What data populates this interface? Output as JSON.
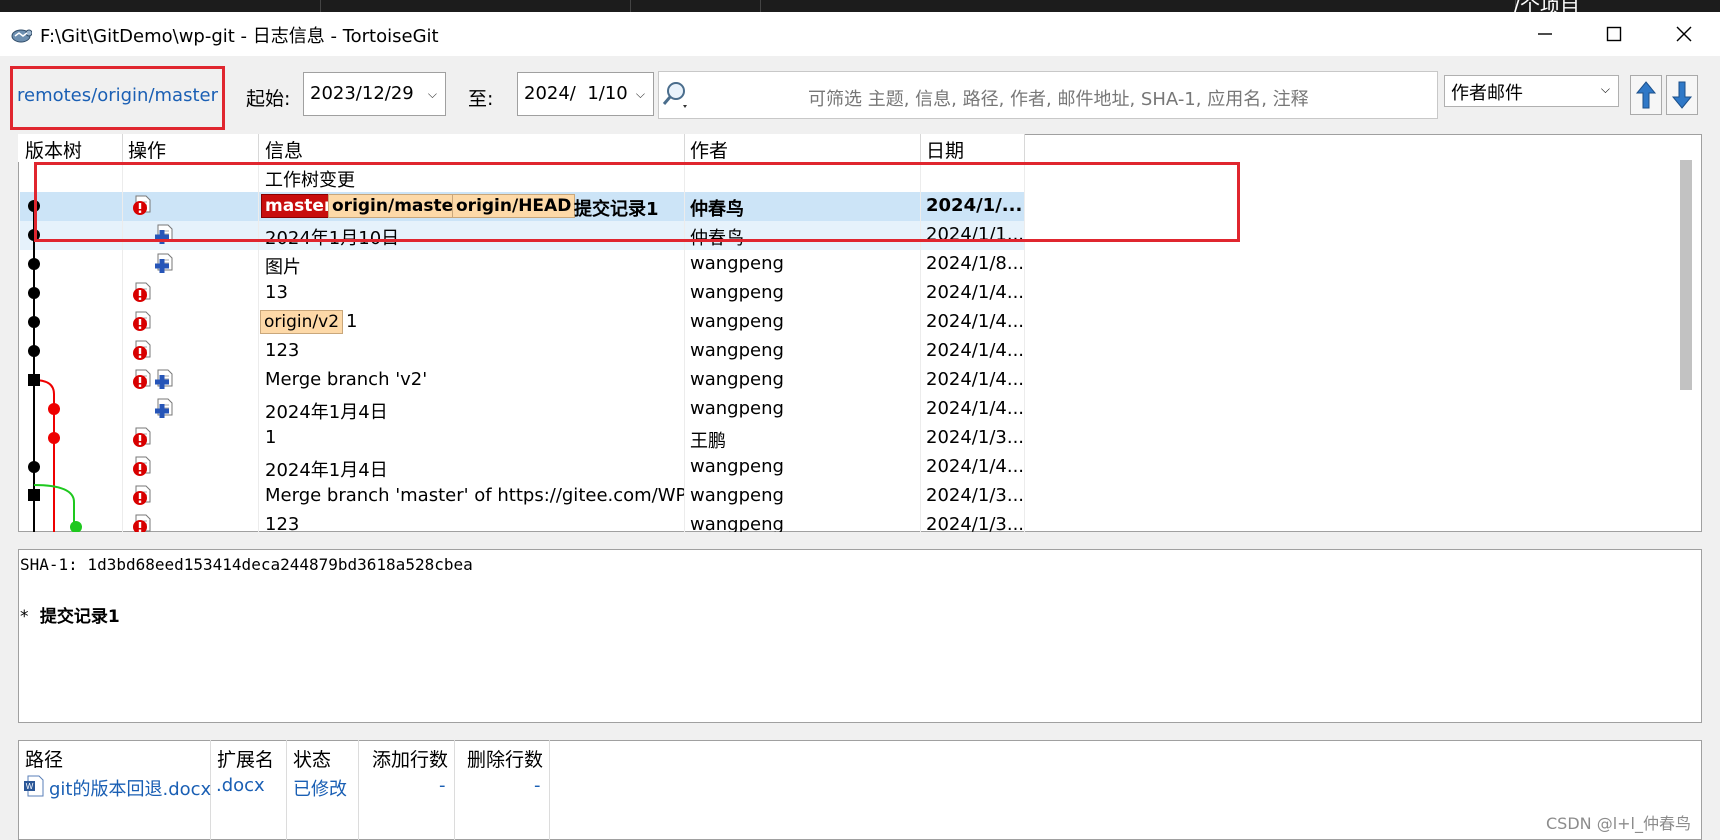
{
  "window": {
    "title": "F:\\Git\\GitDemo\\wp-git - 日志信息 - TortoiseGit",
    "background_text": "/个项目"
  },
  "toolbar": {
    "branch": "remotes/origin/master",
    "start_label": "起始:",
    "start_date": "2023/12/29",
    "end_label": "至:",
    "end_date": "2024/  1/10",
    "search_placeholder": "可筛选 主题, 信息, 路径, 作者, 邮件地址, SHA-1, 应用名, 注释",
    "filter_field": "作者邮件"
  },
  "log": {
    "columns": [
      "版本树",
      "操作",
      "信息",
      "作者",
      "日期"
    ],
    "rows": [
      {
        "message": "工作树变更",
        "author": "",
        "date": ""
      },
      {
        "tags": [
          "master",
          "origin/master",
          "origin/HEAD"
        ],
        "message": "提交记录1",
        "author": "仲春鸟",
        "date": "2024/1/..."
      },
      {
        "message": "2024年1月10日",
        "author": "仲春鸟",
        "date": "2024/1/1..."
      },
      {
        "message": "图片",
        "author": "wangpeng",
        "date": "2024/1/8..."
      },
      {
        "message": "13",
        "author": "wangpeng",
        "date": "2024/1/4..."
      },
      {
        "tags": [
          "origin/v2"
        ],
        "message": "1",
        "author": "wangpeng",
        "date": "2024/1/4..."
      },
      {
        "message": "123",
        "author": "wangpeng",
        "date": "2024/1/4..."
      },
      {
        "message": "Merge branch 'v2'",
        "author": "wangpeng",
        "date": "2024/1/4..."
      },
      {
        "message": "2024年1月4日",
        "author": "wangpeng",
        "date": "2024/1/4..."
      },
      {
        "message": "1",
        "author": "王鹏",
        "date": "2024/1/3..."
      },
      {
        "message": "2024年1月4日",
        "author": "wangpeng",
        "date": "2024/1/4..."
      },
      {
        "message": "Merge branch 'master' of https://gitee.com/WP_S...",
        "author": "wangpeng",
        "date": "2024/1/3..."
      },
      {
        "message": "123",
        "author": "wangpeng",
        "date": "2024/1/3..."
      }
    ]
  },
  "details": {
    "sha": "SHA-1: 1d3bd68eed153414deca244879bd3618a528cbea",
    "bullet": "*",
    "message": "提交记录1"
  },
  "files": {
    "columns": [
      "路径",
      "扩展名",
      "状态",
      "添加行数",
      "删除行数"
    ],
    "rows": [
      {
        "path": "git的版本回退.docx",
        "ext": ".docx",
        "status": "已修改",
        "added": "-",
        "deleted": "-"
      }
    ]
  },
  "watermark": "CSDN @l+l_仲春鸟",
  "colors": {
    "accent_red": "#e0262f",
    "link_blue": "#1a5fb4",
    "selection": "#cce4f7",
    "master_tag": "#c80d0d",
    "remote_tag": "#fdd9a8"
  }
}
